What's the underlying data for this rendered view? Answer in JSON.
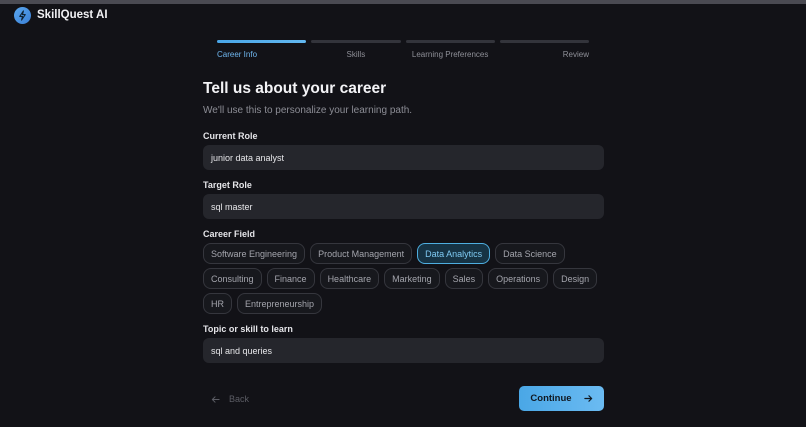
{
  "app": {
    "name": "SkillQuest AI"
  },
  "steps": [
    {
      "label": "Career Info",
      "active": true
    },
    {
      "label": "Skills",
      "active": false
    },
    {
      "label": "Learning Preferences",
      "active": false
    },
    {
      "label": "Review",
      "active": false
    }
  ],
  "page": {
    "title": "Tell us about your career",
    "subtitle": "We'll use this to personalize your learning path."
  },
  "form": {
    "current_role": {
      "label": "Current Role",
      "value": "junior data analyst"
    },
    "target_role": {
      "label": "Target Role",
      "value": "sql master"
    },
    "career_field": {
      "label": "Career Field",
      "selected": "Data Analytics",
      "rows": [
        [
          "Software Engineering",
          "Product Management",
          "Data Analytics",
          "Data Science"
        ],
        [
          "Consulting",
          "Finance",
          "Healthcare",
          "Marketing",
          "Sales",
          "Operations",
          "Design"
        ],
        [
          "HR",
          "Entrepreneurship"
        ]
      ]
    },
    "topic": {
      "label": "Topic or skill to learn",
      "value": "sql and queries"
    }
  },
  "nav": {
    "back_label": "Back",
    "continue_label": "Continue"
  },
  "colors": {
    "accent": "#4aa6e8",
    "background": "#121217",
    "field": "#25262c"
  }
}
